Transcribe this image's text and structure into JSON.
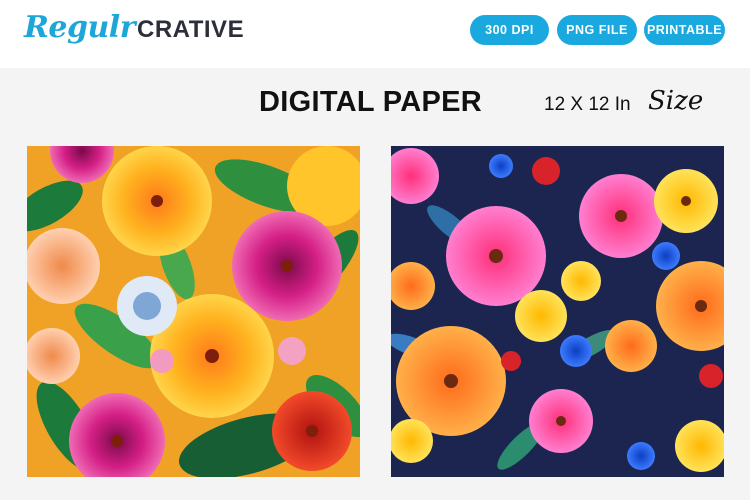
{
  "brand": {
    "script": "Regulr",
    "caps": "CRATIVE"
  },
  "badges": [
    "300 DPI",
    "PNG FILE",
    "PRINTABLE"
  ],
  "headline": "DIGITAL PAPER",
  "size": {
    "text": "12 X 12 In",
    "script": "Size"
  },
  "images": [
    {
      "name": "tropical-hibiscus-pattern"
    },
    {
      "name": "colorful-daisy-pattern"
    }
  ],
  "colors": {
    "accent": "#19a9df",
    "brand_script": "#1da7d8",
    "brand_caps": "#2c2f3a",
    "text": "#111111"
  }
}
